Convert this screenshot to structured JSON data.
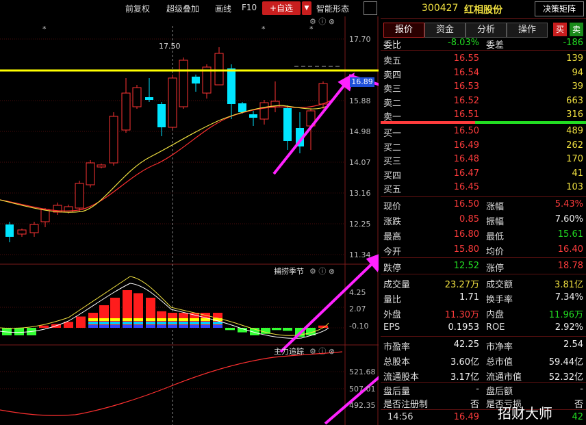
{
  "toolbar": {
    "restore": "前复权",
    "overlay": "超级叠加",
    "draw": "画线",
    "f10": "F10",
    "add_watch": "+自选",
    "dropdown": "▼",
    "smart_pattern": "智能形态"
  },
  "chart": {
    "price_axis": [
      "17.70",
      "15.88",
      "14.98",
      "14.07",
      "13.16",
      "12.25",
      "11.34"
    ],
    "current_price_tag": "16.89",
    "peak_label": "17.50",
    "panel2_title": "捕捞季节",
    "panel2_axis": [
      "4.25",
      "2.07",
      "-0.10"
    ],
    "panel3_title": "主力追踪",
    "panel3_axis": [
      "521.68",
      "507.01",
      "492.35"
    ],
    "colors": {
      "up": "#ff3333",
      "down": "#00e5ff",
      "ma5": "#f0e040",
      "ma10": "#ff4040",
      "highlight": "#ffff00",
      "arrow": "#ff22ff"
    }
  },
  "header": {
    "code": "300427",
    "name": "红相股份",
    "decision_button": "决策矩阵"
  },
  "tabs": [
    "报价",
    "资金",
    "分析",
    "操作"
  ],
  "buy_sell": {
    "buy": "买",
    "sell": "卖"
  },
  "weibi": {
    "label": "委比",
    "value": "-8.03%",
    "diff_label": "委差",
    "diff_value": "-186"
  },
  "sells": [
    {
      "label": "卖五",
      "price": "16.55",
      "vol": "139"
    },
    {
      "label": "卖四",
      "price": "16.54",
      "vol": "94"
    },
    {
      "label": "卖三",
      "price": "16.53",
      "vol": "39"
    },
    {
      "label": "卖二",
      "price": "16.52",
      "vol": "663"
    },
    {
      "label": "卖一",
      "price": "16.51",
      "vol": "316"
    }
  ],
  "buys": [
    {
      "label": "买一",
      "price": "16.50",
      "vol": "489"
    },
    {
      "label": "买二",
      "price": "16.49",
      "vol": "262"
    },
    {
      "label": "买三",
      "price": "16.48",
      "vol": "170"
    },
    {
      "label": "买四",
      "price": "16.47",
      "vol": "41"
    },
    {
      "label": "买五",
      "price": "16.45",
      "vol": "103"
    }
  ],
  "stats": [
    {
      "l1": "现价",
      "v1": "16.50",
      "c1": "red",
      "l2": "涨幅",
      "v2": "5.43%",
      "c2": "red"
    },
    {
      "l1": "涨跌",
      "v1": "0.85",
      "c1": "red",
      "l2": "振幅",
      "v2": "7.60%",
      "c2": "white"
    },
    {
      "l1": "最高",
      "v1": "16.80",
      "c1": "red",
      "l2": "最低",
      "v2": "15.61",
      "c2": "green"
    },
    {
      "l1": "今开",
      "v1": "15.80",
      "c1": "red",
      "l2": "均价",
      "v2": "16.40",
      "c2": "red"
    }
  ],
  "limits": {
    "l1": "跌停",
    "v1": "12.52",
    "l2": "涨停",
    "v2": "18.78"
  },
  "volume_stats": [
    {
      "l1": "成交量",
      "v1": "23.27万",
      "c1": "yellow",
      "l2": "成交额",
      "v2": "3.81亿",
      "c2": "yellow"
    },
    {
      "l1": "量比",
      "v1": "1.71",
      "c1": "white",
      "l2": "换手率",
      "v2": "7.34%",
      "c2": "white"
    },
    {
      "l1": "外盘",
      "v1": "11.30万",
      "c1": "red",
      "l2": "内盘",
      "v2": "11.96万",
      "c2": "green"
    },
    {
      "l1": "EPS",
      "v1": "0.1953",
      "c1": "white",
      "l2": "ROE",
      "v2": "2.92%",
      "c2": "white"
    }
  ],
  "valuation": [
    {
      "l1": "市盈率",
      "v1": "42.25",
      "l2": "市净率",
      "v2": "2.54"
    },
    {
      "l1": "总股本",
      "v1": "3.60亿",
      "l2": "总市值",
      "v2": "59.44亿"
    },
    {
      "l1": "流通股本",
      "v1": "3.17亿",
      "l2": "流通市值",
      "v2": "52.32亿"
    }
  ],
  "after_hours": {
    "l1": "盘后量",
    "v1": "-",
    "l2": "盘后额",
    "v2": "-"
  },
  "register": {
    "l1": "是否注册制",
    "v1": "否",
    "l2": "是否亏损",
    "v2": "否"
  },
  "tick": {
    "time": "14:56",
    "price": "16.49",
    "vol": "42"
  },
  "watermark": "招财大师"
}
